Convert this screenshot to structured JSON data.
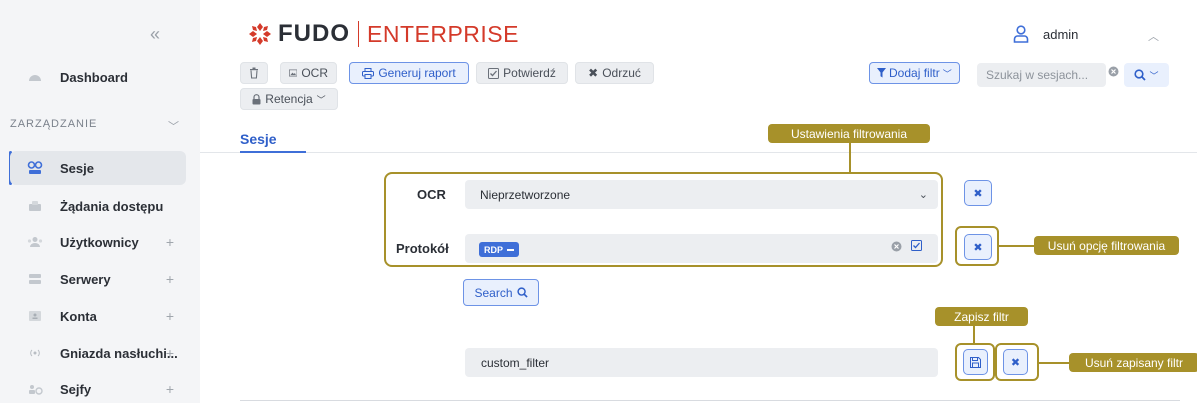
{
  "app": {
    "logo_brand": "FUDO",
    "logo_edition": "ENTERPRISE",
    "user_name": "admin"
  },
  "sidebar": {
    "dashboard_label": "Dashboard",
    "section_label": "ZARZĄDZANIE",
    "items": [
      {
        "label": "Sesje",
        "icon": "sessions-icon",
        "plus": false,
        "active": true
      },
      {
        "label": "Żądania dostępu",
        "icon": "access-requests-icon",
        "plus": false
      },
      {
        "label": "Użytkownicy",
        "icon": "users-icon",
        "plus": true
      },
      {
        "label": "Serwery",
        "icon": "servers-icon",
        "plus": true
      },
      {
        "label": "Konta",
        "icon": "accounts-icon",
        "plus": true
      },
      {
        "label": "Gniazda nasłuchi...",
        "icon": "listeners-icon",
        "plus": true
      },
      {
        "label": "Sejfy",
        "icon": "safes-icon",
        "plus": true
      }
    ],
    "plus_symbol": "+"
  },
  "toolbar": {
    "delete_icon": "trash-icon",
    "ocr_label": "OCR",
    "generate_report_label": "Generuj raport",
    "confirm_label": "Potwierdź",
    "reject_label": "Odrzuć",
    "retention_label": "Retencja",
    "add_filter_label": "Dodaj filtr",
    "search_placeholder": "Szukaj w sesjach..."
  },
  "tabs": {
    "sessions_label": "Sesje"
  },
  "filters": {
    "ocr_label": "OCR",
    "ocr_value": "Nieprzetworzone",
    "protocol_label": "Protokół",
    "protocol_tag": "RDP",
    "search_button_label": "Search",
    "saved_filter_value": "custom_filter"
  },
  "annotations": {
    "filter_settings": "Ustawienia filtrowania",
    "remove_filter_option": "Usuń opcję filtrowania",
    "save_filter": "Zapisz filtr",
    "remove_saved_filter": "Usuń zapisany filtr"
  },
  "colors": {
    "accent": "#3f6fd8",
    "brand_red": "#d43a2a",
    "annotation": "#a7912a"
  }
}
